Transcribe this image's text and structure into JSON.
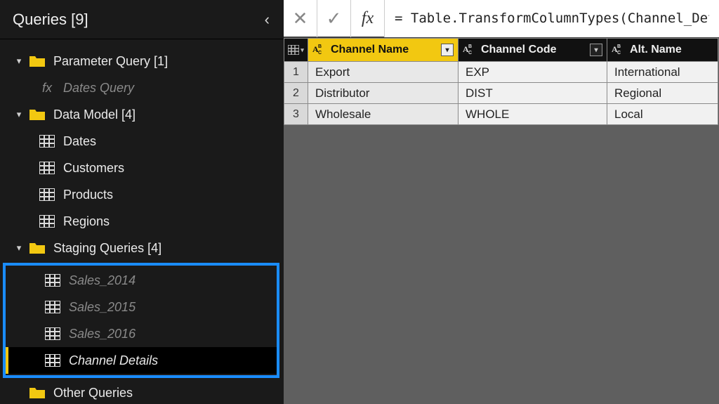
{
  "panel": {
    "title": "Queries [9]",
    "collapse_glyph": "‹"
  },
  "tree": {
    "param_group": "Parameter Query [1]",
    "dates_query": "Dates Query",
    "data_model": "Data Model [4]",
    "dates": "Dates",
    "customers": "Customers",
    "products": "Products",
    "regions": "Regions",
    "staging": "Staging Queries [4]",
    "sales_2014": "Sales_2014",
    "sales_2015": "Sales_2015",
    "sales_2016": "Sales_2016",
    "channel_details": "Channel Details",
    "other": "Other Queries"
  },
  "formula": {
    "cancel_glyph": "✕",
    "commit_glyph": "✓",
    "fx_glyph": "fx",
    "value": "= Table.TransformColumnTypes(Channel_Deta"
  },
  "grid": {
    "columns": {
      "name": "Channel Name",
      "code": "Channel Code",
      "alt": "Alt. Name"
    },
    "rows": [
      {
        "n": "1",
        "name": "Export",
        "code": "EXP",
        "alt": "International"
      },
      {
        "n": "2",
        "name": "Distributor",
        "code": "DIST",
        "alt": "Regional"
      },
      {
        "n": "3",
        "name": "Wholesale",
        "code": "WHOLE",
        "alt": "Local"
      }
    ]
  },
  "icons": {
    "triangle_down": "▾",
    "triangle_open": "▸"
  },
  "chart_data": {
    "type": "table",
    "title": "Channel Details",
    "columns": [
      "Channel Name",
      "Channel Code",
      "Alt. Name"
    ],
    "rows": [
      [
        "Export",
        "EXP",
        "International"
      ],
      [
        "Distributor",
        "DIST",
        "Regional"
      ],
      [
        "Wholesale",
        "WHOLE",
        "Local"
      ]
    ]
  }
}
